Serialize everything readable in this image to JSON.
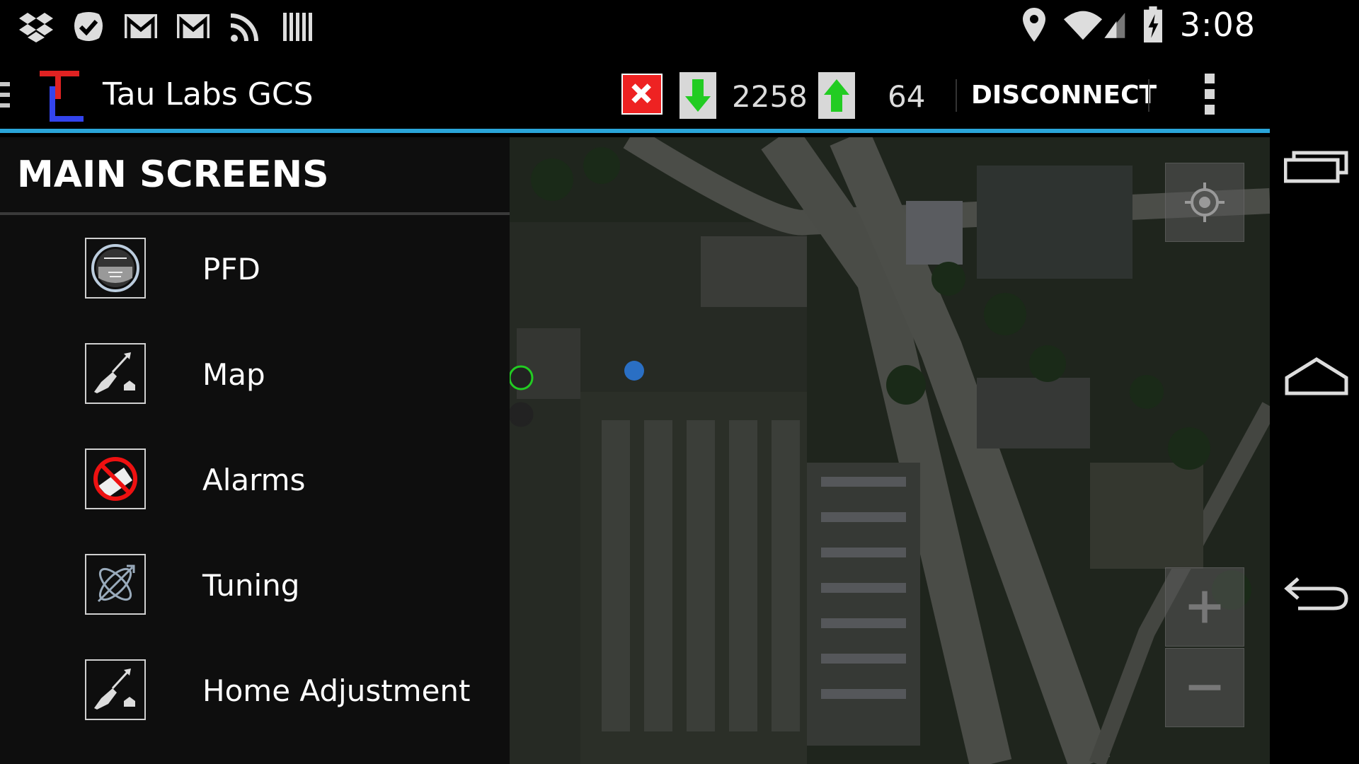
{
  "status_bar": {
    "time": "3:08",
    "left_icons": [
      "dropbox-icon",
      "check-icon",
      "gmail-icon",
      "gmail-icon",
      "rss-icon",
      "barcode-icon"
    ],
    "right_icons": [
      "location-icon",
      "wifi-icon",
      "signal-icon",
      "battery-charging-icon"
    ]
  },
  "action_bar": {
    "title": "Tau Labs GCS",
    "rx_count": "2258",
    "tx_count": "64",
    "disconnect_label": "DISCONNECT"
  },
  "drawer": {
    "header": "MAIN SCREENS",
    "items": [
      {
        "label": "PFD",
        "icon": "pfd-icon"
      },
      {
        "label": "Map",
        "icon": "map-plane-icon"
      },
      {
        "label": "Alarms",
        "icon": "alarm-icon"
      },
      {
        "label": "Tuning",
        "icon": "tuning-icon"
      },
      {
        "label": "Home Adjustment",
        "icon": "home-adjust-icon"
      }
    ]
  },
  "map": {
    "controls": [
      "my-location-button",
      "zoom-in-button",
      "zoom-out-button"
    ]
  },
  "colors": {
    "accent": "#2aa5d9",
    "error_badge": "#e22222",
    "arrow_green": "#22cc22"
  }
}
